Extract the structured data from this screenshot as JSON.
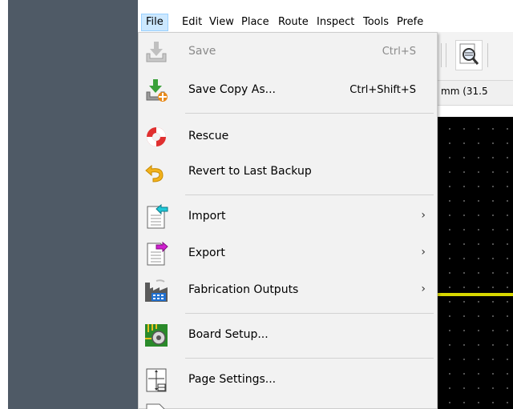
{
  "menubar": {
    "items": [
      "File",
      "Edit",
      "View",
      "Place",
      "Route",
      "Inspect",
      "Tools",
      "Prefe"
    ]
  },
  "status": {
    "unit_text": "mm (31.5"
  },
  "file_menu": {
    "items": [
      {
        "label": "Save",
        "shortcut": "Ctrl+S",
        "enabled": false,
        "icon": "save-icon"
      },
      {
        "label": "Save Copy As...",
        "shortcut": "Ctrl+Shift+S",
        "enabled": true,
        "icon": "save-copy-icon"
      },
      {
        "label": "Rescue",
        "shortcut": "",
        "enabled": true,
        "icon": "lifebuoy-icon"
      },
      {
        "label": "Revert to Last Backup",
        "shortcut": "",
        "enabled": true,
        "icon": "revert-icon"
      },
      {
        "label": "Import",
        "submenu": true,
        "enabled": true,
        "icon": "import-icon"
      },
      {
        "label": "Export",
        "submenu": true,
        "enabled": true,
        "icon": "export-icon"
      },
      {
        "label": "Fabrication Outputs",
        "submenu": true,
        "enabled": true,
        "icon": "factory-icon"
      },
      {
        "label": "Board Setup...",
        "shortcut": "",
        "enabled": true,
        "icon": "board-setup-icon"
      },
      {
        "label": "Page Settings...",
        "shortcut": "",
        "enabled": true,
        "icon": "page-settings-icon"
      }
    ]
  },
  "colors": {
    "panel": "#4f5a66",
    "menu_bg": "#f2f2f2",
    "menubar_active": "#cce8ff",
    "canvas": "#000000",
    "track": "#d8d800"
  }
}
